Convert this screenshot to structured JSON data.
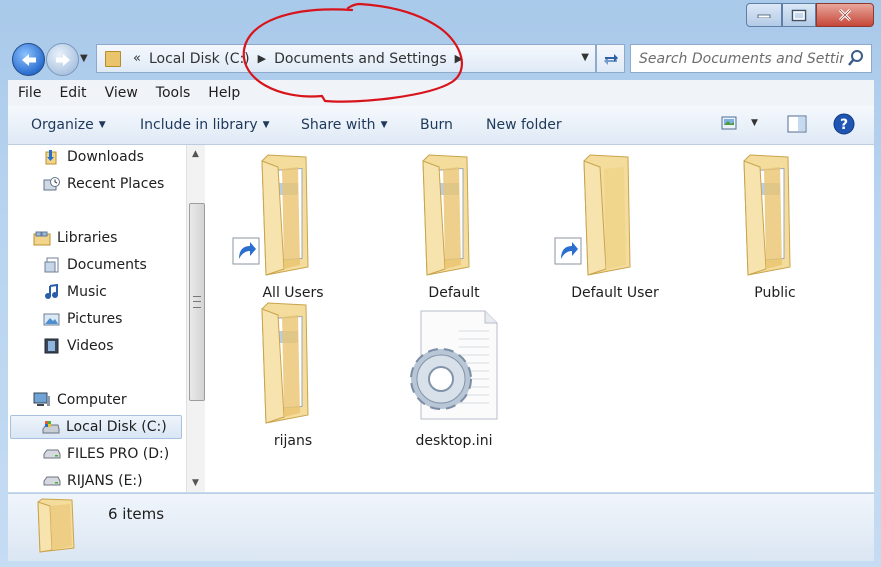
{
  "window": {
    "controls": {
      "minimize": "–",
      "maximize": "□",
      "close": "✕"
    }
  },
  "address_bar": {
    "overflow_chevron": "«",
    "segments": [
      "Local Disk (C:)",
      "Documents and Settings"
    ]
  },
  "search": {
    "placeholder": "Search Documents and Settings"
  },
  "menu": [
    "File",
    "Edit",
    "View",
    "Tools",
    "Help"
  ],
  "commands": {
    "organize": "Organize",
    "include_in_library": "Include in library",
    "share_with": "Share with",
    "burn": "Burn",
    "new_folder": "New folder"
  },
  "nav_pane": {
    "favorites": [
      "Downloads",
      "Recent Places"
    ],
    "libraries_header": "Libraries",
    "libraries": [
      "Documents",
      "Music",
      "Pictures",
      "Videos"
    ],
    "computer_header": "Computer",
    "drives": [
      "Local Disk (C:)",
      "FILES PRO (D:)",
      "RIJANS (E:)"
    ],
    "selected": "Local Disk (C:)"
  },
  "items": [
    {
      "name": "All Users",
      "type": "folder",
      "shortcut": true
    },
    {
      "name": "Default",
      "type": "folder",
      "shortcut": false
    },
    {
      "name": "Default User",
      "type": "folder",
      "shortcut": true
    },
    {
      "name": "Public",
      "type": "folder",
      "shortcut": false
    },
    {
      "name": "rijans",
      "type": "folder",
      "shortcut": false
    },
    {
      "name": "desktop.ini",
      "type": "config-file",
      "shortcut": false
    }
  ],
  "status": {
    "count": "6 items"
  },
  "colors": {
    "annotation": "#d8141b",
    "folder": "#f2d58b",
    "accent": "#2a6fd0"
  }
}
